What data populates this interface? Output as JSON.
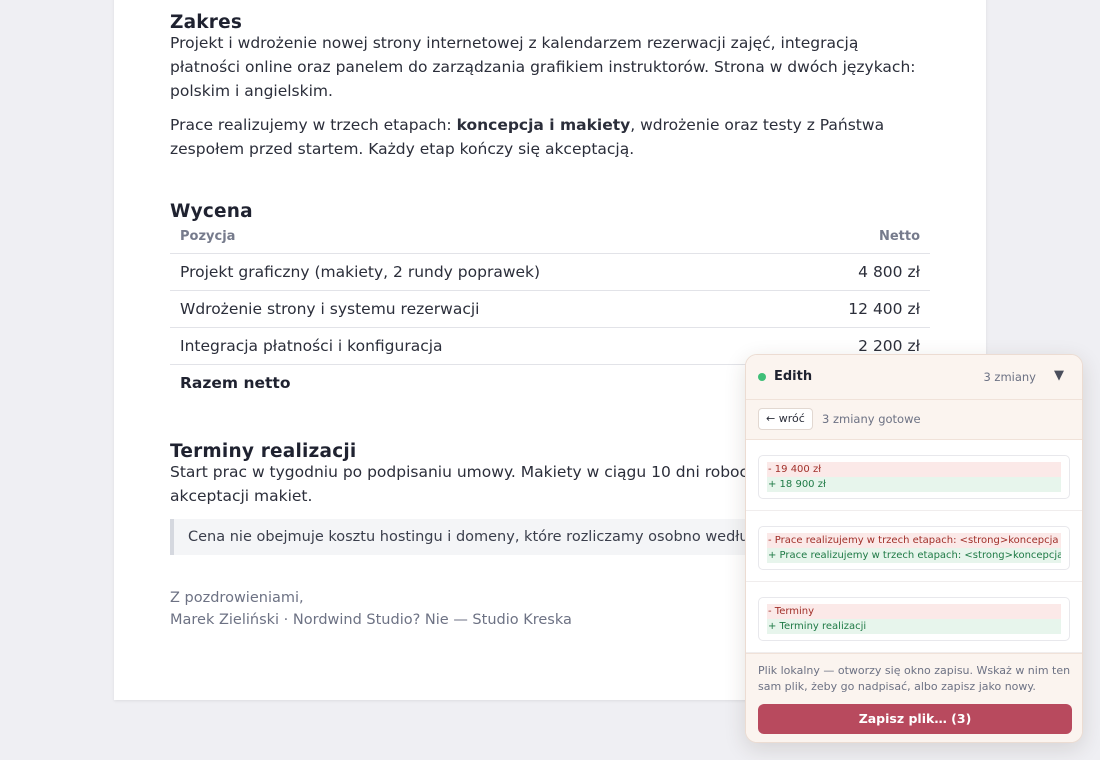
{
  "document": {
    "sections": {
      "zakres": {
        "heading": "Zakres",
        "paragraph": "Projekt i wdrożenie nowej strony internetowej z kalendarzem rezerwacji zajęć, integracją płatności online oraz panelem do zarządzania grafikiem instruktorów. Strona w dwóch językach: polskim i angielskim.",
        "stages_pre": "Prace realizujemy w trzech etapach: ",
        "stages_strong": "koncepcja i makiety",
        "stages_post": ", wdrożenie oraz testy z Państwa zespołem przed startem. Każdy etap kończy się akceptacją."
      },
      "wycena": {
        "heading": "Wycena",
        "columns": [
          "Pozycja",
          "Netto"
        ],
        "rows": [
          {
            "item": "Projekt graficzny (makiety, 2 rundy poprawek)",
            "net": "4 800 zł"
          },
          {
            "item": "Wdrożenie strony i systemu rezerwacji",
            "net": "12 400 zł"
          },
          {
            "item": "Integracja płatności i konfiguracja",
            "net": "2 200 zł"
          }
        ],
        "total_label": "Razem netto"
      },
      "terminy": {
        "heading": "Terminy realizacji",
        "paragraph": "Start prac w tygodniu po podpisaniu umowy. Makiety w ciągu 10 dni roboczych, tygodniach od akceptacji makiet.",
        "note": "Cena nie obejmuje kosztu hostingu i domeny, które rozliczamy osobno według c"
      }
    },
    "signature": {
      "greeting": "Z pozdrowieniami,",
      "name": "Marek Zieliński · Nordwind Studio? Nie — Studio Kreska"
    }
  },
  "panel": {
    "user": "Edith",
    "status_color": "#3fbf78",
    "changes_count": "3 zmiany",
    "toggle_icon": "▼",
    "back_label": "← wróć",
    "ready_label": "3 zmiany gotowe",
    "diffs": [
      {
        "removed": "- 19 400 zł",
        "added": "+ 18 900 zł"
      },
      {
        "removed": "- Prace realizujemy w trzech etapach: <strong>koncepcja i makiety</strong>",
        "added": "+ Prace realizujemy w trzech etapach: <strong>koncepcja i makiety</strong>"
      },
      {
        "removed": "- Terminy",
        "added": "+ Terminy realizacji"
      }
    ],
    "footer_note": "Plik lokalny — otworzy się okno zapisu. Wskaż w nim ten sam plik, żeby go nadpisać, albo zapisz jako nowy.",
    "save_label": "Zapisz plik… (3)",
    "accent_color": "#b84a5e"
  }
}
